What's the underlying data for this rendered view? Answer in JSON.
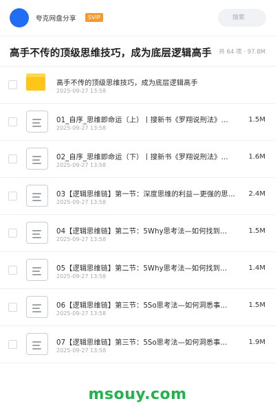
{
  "header": {
    "brand": "夸克网盘分享",
    "badge": "SVIP",
    "search_placeholder": "搜索",
    "accent_color": "#1f6ef5",
    "badge_color": "#f59a2f"
  },
  "share": {
    "title": "高手不传的顶级思维技巧，成为底层逻辑高手",
    "summary": "共 64 项 · 97.8M"
  },
  "files": [
    {
      "type": "folder",
      "name": "高手不传的顶级思维技巧，成为底层逻辑高手",
      "date": "2025-09-27 13:58",
      "size": ""
    },
    {
      "type": "doc",
      "name": "01_自序_思维即命运（上）丨搜新书《罗翔说刑法》…",
      "date": "2025-09-27 13:58",
      "size": "1.5M"
    },
    {
      "type": "doc",
      "name": "02_自序_思维即命运（下）丨搜新书《罗翔说刑法》…",
      "date": "2025-09-27 13:58",
      "size": "1.6M"
    },
    {
      "type": "doc",
      "name": "03【逻辑思维链】第一节：深度思维的利益—更强的思…",
      "date": "2025-09-27 13:58",
      "size": "2.4M"
    },
    {
      "type": "doc",
      "name": "04【逻辑思维链】第二节：5Why思考法—如何找到…",
      "date": "2025-09-27 13:58",
      "size": "1.5M"
    },
    {
      "type": "doc",
      "name": "05【逻辑思维链】第二节：5Why思考法—如何找到…",
      "date": "2025-09-27 13:58",
      "size": "1.4M"
    },
    {
      "type": "doc",
      "name": "06【逻辑思维链】第三节：5So思考法—如何洞悉事…",
      "date": "2025-09-27 13:58",
      "size": "1.5M"
    },
    {
      "type": "doc",
      "name": "07【逻辑思维链】第三节：5So思考法—如何洞悉事…",
      "date": "2025-09-27 13:58",
      "size": "1.9M"
    }
  ],
  "footer": {
    "watermark": "msouy.com",
    "color": "#22b24c"
  }
}
